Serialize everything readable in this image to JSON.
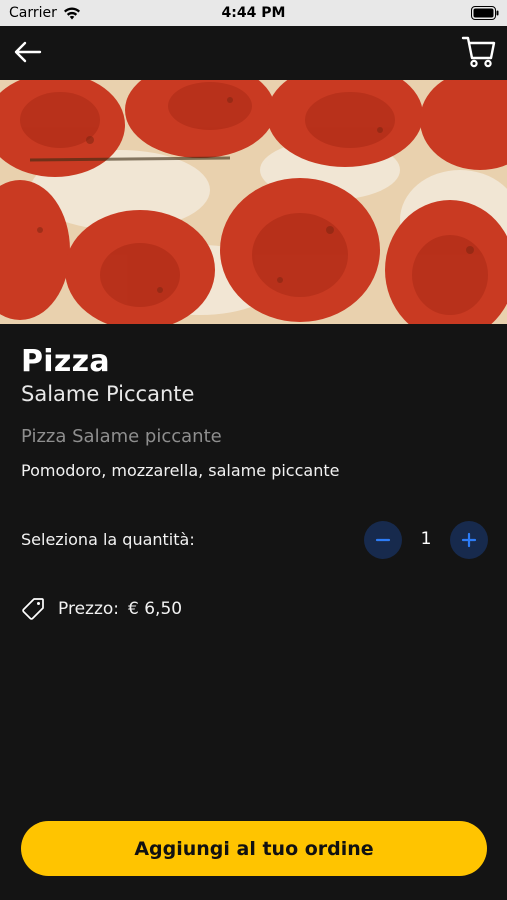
{
  "status_bar": {
    "carrier": "Carrier",
    "time": "4:44 PM"
  },
  "nav": {
    "back_icon": "arrow-left-icon",
    "cart_icon": "cart-icon"
  },
  "hero": {
    "image": "pepperoni-pizza-photo",
    "active_page": 1,
    "page_count": 2,
    "active_dot_color": "#1e7bff"
  },
  "product": {
    "category": "Pizza",
    "name": "Salame Piccante",
    "description": "Pizza Salame piccante",
    "ingredients": "Pomodoro, mozzarella, salame piccante"
  },
  "quantity": {
    "label": "Seleziona la quantità:",
    "value": "1",
    "minus_icon": "minus-icon",
    "plus_icon": "plus-icon"
  },
  "price": {
    "label": "Prezzo:",
    "value": "€ 6,50",
    "icon": "price-tag-icon"
  },
  "cta": {
    "label": "Aggiungi al tuo ordine",
    "color": "#ffc400"
  },
  "colors": {
    "background": "#141414",
    "accent_blue": "#1e7bff",
    "stepper_bg": "#172a4d"
  }
}
